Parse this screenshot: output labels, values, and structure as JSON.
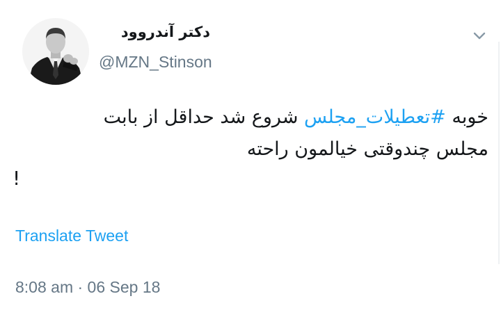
{
  "tweet": {
    "author": {
      "display_name": "دکتر آندروود",
      "handle": "@MZN_Stinson",
      "avatar_icon": "avatar-photo"
    },
    "menu_icon": "chevron-down-icon",
    "text": {
      "line1_before": "خوبه ",
      "hashtag": "#تعطیلات_مجلس",
      "line1_after": " شروع شد حداقل از بابت",
      "line2": "مجلس چندوقتی خیالمون راحته",
      "line3": "!"
    },
    "translate_label": "Translate Tweet",
    "timestamp": "8:08 am · 06 Sep 18"
  },
  "colors": {
    "text": "#14171a",
    "secondary": "#657786",
    "link": "#1da1f2",
    "background": "#ffffff"
  }
}
